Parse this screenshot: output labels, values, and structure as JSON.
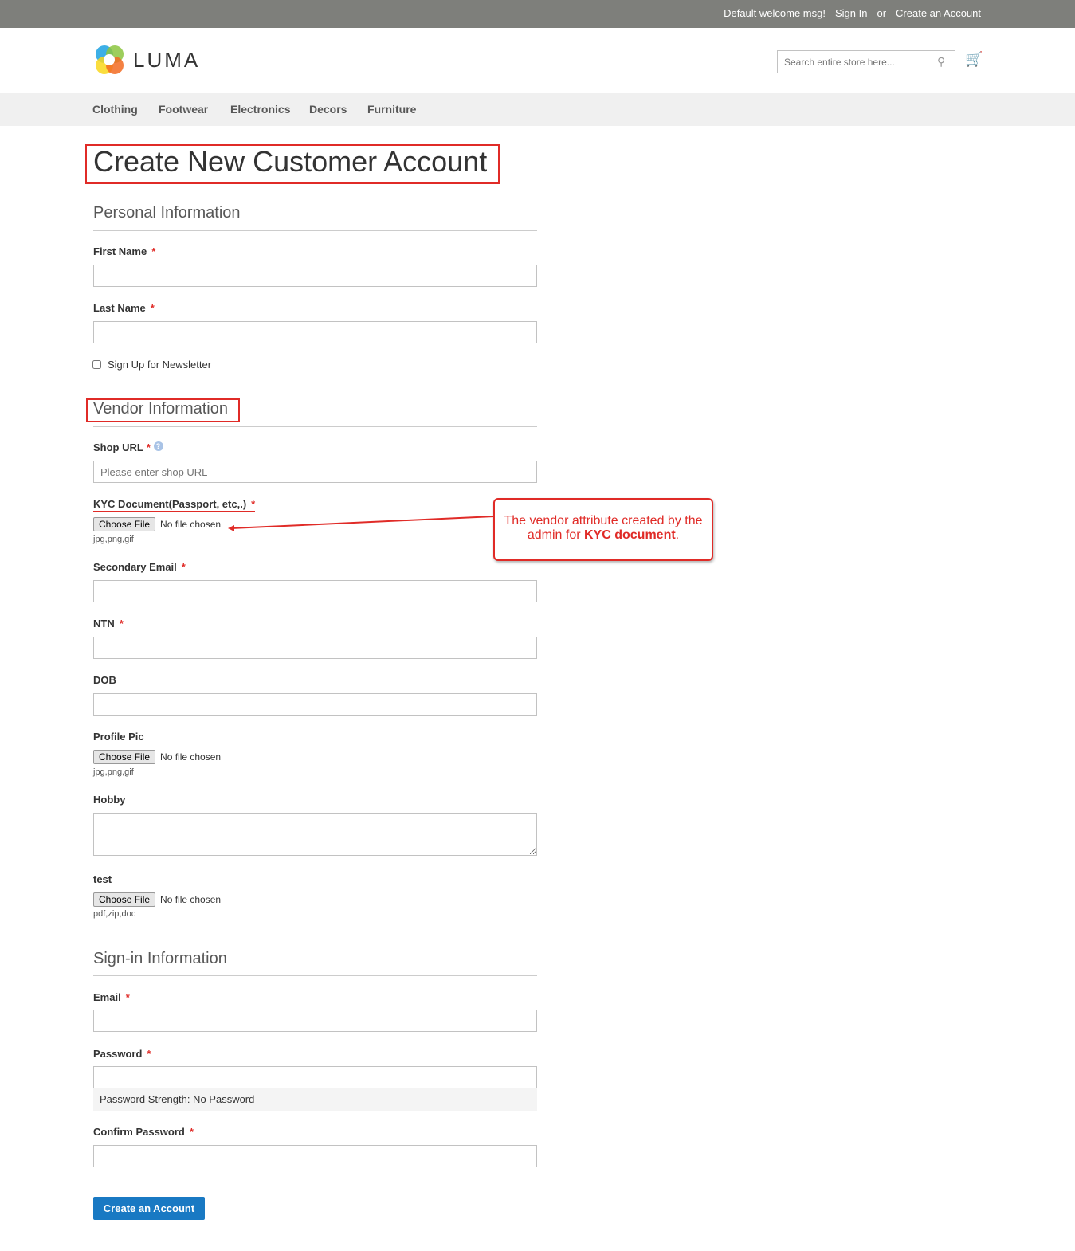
{
  "topbar": {
    "welcome": "Default welcome msg!",
    "sign_in": "Sign In",
    "or": "or",
    "create_account": "Create an Account"
  },
  "header": {
    "logo": "LUMA",
    "search_placeholder": "Search entire store here..."
  },
  "nav": [
    "Clothing",
    "Footwear",
    "Electronics",
    "Decors",
    "Furniture"
  ],
  "page_title": "Create New Customer Account",
  "personal": {
    "heading": "Personal Information",
    "first_name": "First Name",
    "last_name": "Last Name",
    "newsletter": "Sign Up for Newsletter"
  },
  "vendor": {
    "heading": "Vendor Information",
    "shop_url": "Shop URL",
    "shop_url_placeholder": "Please enter shop URL",
    "kyc": "KYC Document(Passport, etc,.)",
    "choose_file": "Choose File",
    "no_file": "No file chosen",
    "kyc_note": "jpg,png,gif",
    "secondary_email": "Secondary Email",
    "ntn": "NTN",
    "dob": "DOB",
    "profile_pic": "Profile Pic",
    "profile_note": "jpg,png,gif",
    "hobby": "Hobby",
    "test": "test",
    "test_note": "pdf,zip,doc"
  },
  "signin": {
    "heading": "Sign-in Information",
    "email": "Email",
    "password": "Password",
    "strength": "Password Strength: No Password",
    "confirm": "Confirm Password"
  },
  "submit": "Create an Account",
  "annotation": {
    "text_pre": "The vendor attribute created by the admin for ",
    "text_bold": "KYC document",
    "text_post": "."
  },
  "required_mark": "*"
}
